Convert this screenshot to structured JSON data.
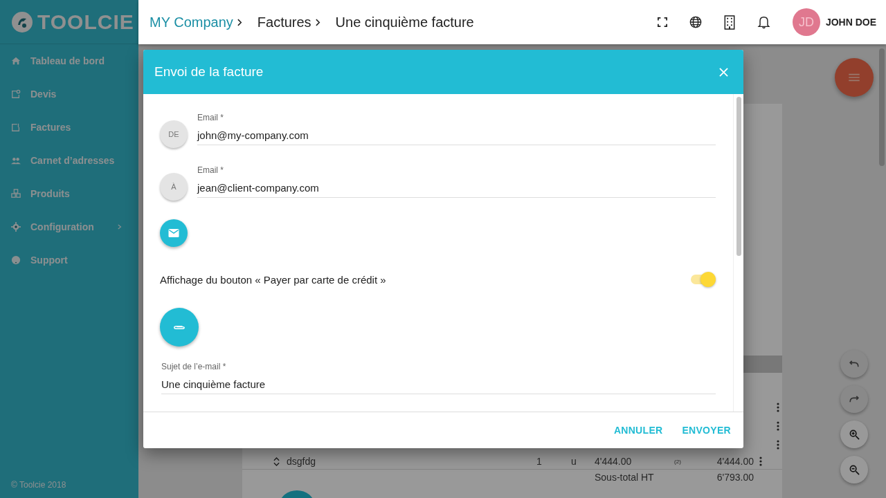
{
  "brand": "TOOLCIE",
  "sidebar": {
    "items": [
      {
        "label": "Tableau de bord",
        "has_submenu": false
      },
      {
        "label": "Devis",
        "has_submenu": false
      },
      {
        "label": "Factures",
        "has_submenu": false
      },
      {
        "label": "Carnet d’adresses",
        "has_submenu": false
      },
      {
        "label": "Produits",
        "has_submenu": false
      },
      {
        "label": "Configuration",
        "has_submenu": true
      },
      {
        "label": "Support",
        "has_submenu": false
      }
    ],
    "footer": "© Toolcie 2018"
  },
  "breadcrumb": [
    {
      "label": "MY Company",
      "link": true
    },
    {
      "label": "Factures",
      "link": false
    },
    {
      "label": "Une cinquième facture",
      "link": false
    }
  ],
  "user": {
    "initials": "JD",
    "name": "JOHN DOE"
  },
  "table": {
    "rows": [
      {
        "cells": [
          "dsgfdg",
          "1",
          "u",
          "4'444.00",
          "(2)",
          "4'444.00"
        ]
      }
    ],
    "subtotal": {
      "label": "Sous-total HT",
      "value": "6'793.00"
    }
  },
  "dialog": {
    "title": "Envoi de la facture",
    "senders": [
      {
        "badge": "DE",
        "label": "Email *",
        "value": "john@my-company.com"
      },
      {
        "badge": "À",
        "label": "Email *",
        "value": "jean@client-company.com"
      }
    ],
    "pay_toggle": {
      "label": "Affichage du bouton « Payer par carte de crédit »",
      "on": true
    },
    "subject": {
      "label": "Sujet de l’e-mail *",
      "value": "Une cinquième facture"
    },
    "actions": [
      "ANNULER",
      "ENVOYER"
    ]
  }
}
